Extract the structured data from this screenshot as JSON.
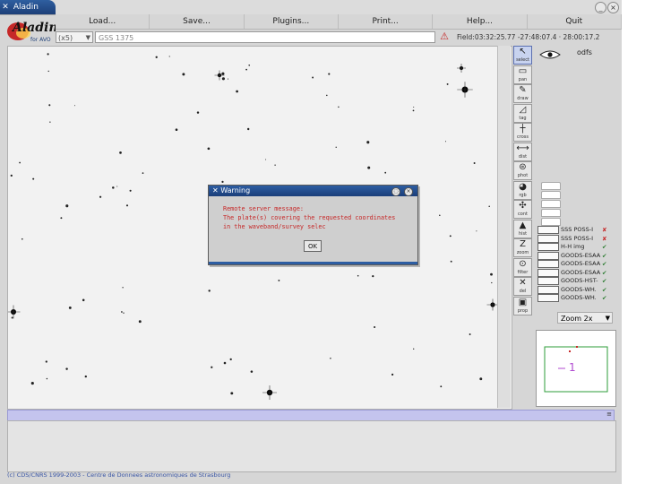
{
  "window": {
    "title": "Aladin",
    "minimize_glyph": "_",
    "close_glyph": "×"
  },
  "menu": [
    {
      "label": "Load..."
    },
    {
      "label": "Save..."
    },
    {
      "label": "Plugins..."
    },
    {
      "label": "Print..."
    },
    {
      "label": "Help..."
    },
    {
      "label": "Quit"
    }
  ],
  "logo": {
    "text": "Aladin",
    "subtitle": "for AVO"
  },
  "toolbar": {
    "frame_value": "(x5)",
    "location_value": "GSS 1375",
    "coords": "Field:03:32:25.77 -27:48:07.4 · 28:00:17.2"
  },
  "tools": [
    {
      "label": "select",
      "glyph": "↖"
    },
    {
      "label": "pan",
      "glyph": "▭"
    },
    {
      "label": "draw",
      "glyph": "✎"
    },
    {
      "label": "tag",
      "glyph": "◿"
    },
    {
      "label": "cross",
      "glyph": "┼"
    },
    {
      "label": "dist",
      "glyph": "⟷"
    },
    {
      "label": "phot",
      "glyph": "⊜"
    },
    {
      "label": "rgb",
      "glyph": "◕"
    },
    {
      "label": "cont",
      "glyph": "✣"
    },
    {
      "label": "hist",
      "glyph": "▲"
    },
    {
      "label": "zoom",
      "glyph": "Z"
    },
    {
      "label": "filter",
      "glyph": "⊙"
    },
    {
      "label": "del",
      "glyph": "✕"
    },
    {
      "label": "prop",
      "glyph": "▣"
    }
  ],
  "planes": {
    "header": "odfs",
    "rows": [
      {
        "name": "SSS POSS-I",
        "status": "bad"
      },
      {
        "name": "SSS POSS-I",
        "status": "bad"
      },
      {
        "name": "H-H img",
        "status": "ok"
      },
      {
        "name": "GOODS-ESAA",
        "status": "ok"
      },
      {
        "name": "GOODS-ESAA",
        "status": "ok"
      },
      {
        "name": "GOODS-ESAA",
        "status": "ok"
      },
      {
        "name": "GOODS-HST-",
        "status": "ok"
      },
      {
        "name": "GOODS-WH.",
        "status": "ok"
      },
      {
        "name": "GOODS-WH.",
        "status": "ok"
      }
    ],
    "ok_mark": "✔",
    "bad_mark": "✘"
  },
  "zoom": {
    "label": "Zoom 2x"
  },
  "zoom_marker": "1",
  "dialog": {
    "title": "Warning",
    "lines": [
      "Remote server message:",
      "The plate(s) covering the requested coordinates",
      "in the waveband/survey selec"
    ],
    "ok_label": "OK"
  },
  "status": {
    "right_glyph": "≡"
  },
  "credits": "(c) CDS/CNRS 1999-2003 - Centre de Donnees astronomiques de Strasbourg",
  "colors": {
    "accent": "#2d5da2",
    "error_text": "#c62828",
    "status_band": "#c4c4ee",
    "credits": "#3a56a6"
  }
}
